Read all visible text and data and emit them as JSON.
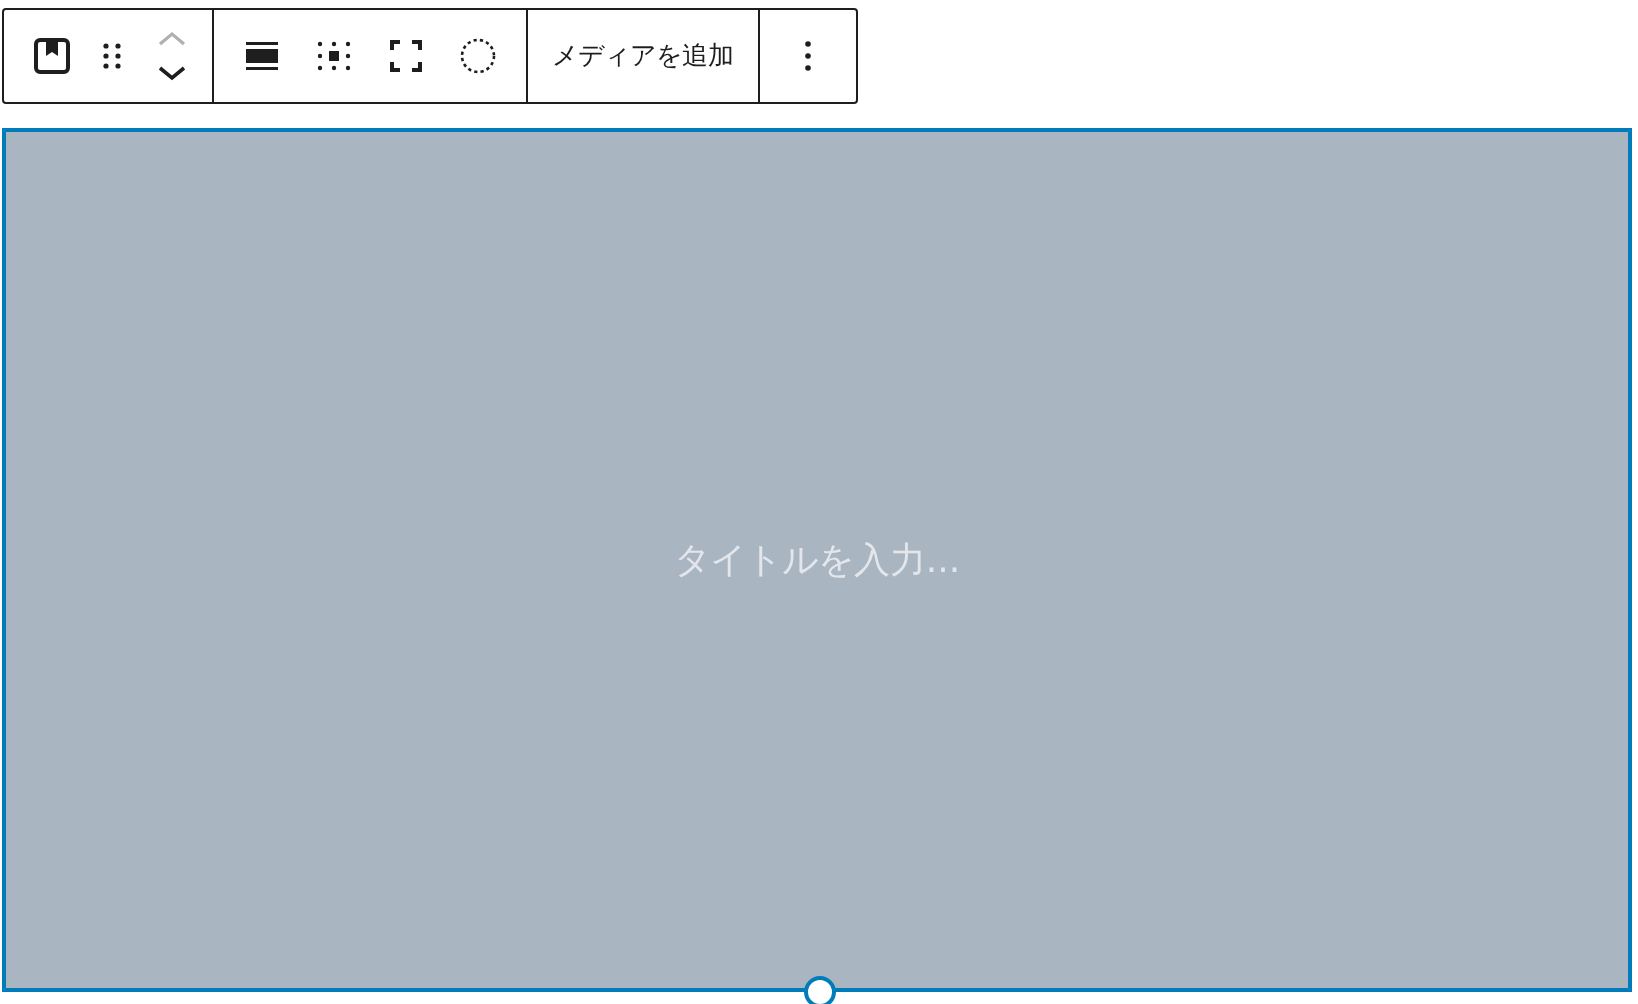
{
  "toolbar": {
    "groups": [
      {
        "items": [
          {
            "kind": "block-type"
          },
          {
            "kind": "drag"
          },
          {
            "kind": "mover",
            "up_disabled": true,
            "down_disabled": false
          }
        ]
      },
      {
        "items": [
          {
            "kind": "align"
          },
          {
            "kind": "position"
          },
          {
            "kind": "full-height"
          },
          {
            "kind": "duotone"
          }
        ]
      },
      {
        "items": [
          {
            "kind": "text",
            "label": "メディアを追加"
          }
        ]
      },
      {
        "items": [
          {
            "kind": "more"
          }
        ]
      }
    ]
  },
  "cover": {
    "title_placeholder": "タイトルを入力..."
  }
}
